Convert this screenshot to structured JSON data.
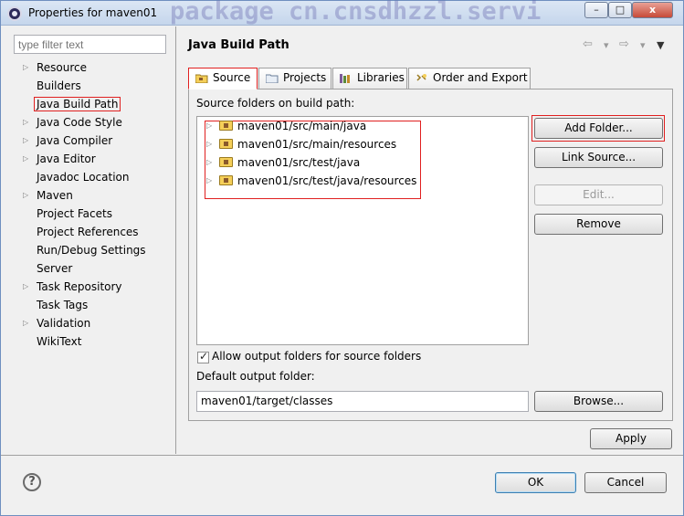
{
  "window": {
    "title": "Properties for maven01",
    "watermark": "package cn.cnsdhzzl.servi",
    "controls": {
      "minimize": "–",
      "maximize": "□",
      "close": "x"
    }
  },
  "filter": {
    "placeholder": "type filter text"
  },
  "nav": {
    "items": [
      {
        "label": "Resource",
        "expandable": true
      },
      {
        "label": "Builders",
        "expandable": false
      },
      {
        "label": "Java Build Path",
        "expandable": false,
        "selected": true
      },
      {
        "label": "Java Code Style",
        "expandable": true
      },
      {
        "label": "Java Compiler",
        "expandable": true
      },
      {
        "label": "Java Editor",
        "expandable": true
      },
      {
        "label": "Javadoc Location",
        "expandable": false
      },
      {
        "label": "Maven",
        "expandable": true
      },
      {
        "label": "Project Facets",
        "expandable": false
      },
      {
        "label": "Project References",
        "expandable": false
      },
      {
        "label": "Run/Debug Settings",
        "expandable": false
      },
      {
        "label": "Server",
        "expandable": false
      },
      {
        "label": "Task Repository",
        "expandable": true
      },
      {
        "label": "Task Tags",
        "expandable": false
      },
      {
        "label": "Validation",
        "expandable": true
      },
      {
        "label": "WikiText",
        "expandable": false
      }
    ]
  },
  "page": {
    "title": "Java Build Path",
    "history": {
      "back": "⇦",
      "back_menu": "▾",
      "forward": "⇨",
      "forward_menu": "▾",
      "menu": "▼"
    }
  },
  "tabs": [
    {
      "label": "Source",
      "active": true
    },
    {
      "label": "Projects",
      "active": false
    },
    {
      "label": "Libraries",
      "active": false
    },
    {
      "label": "Order and Export",
      "active": false
    }
  ],
  "source": {
    "folders_label": "Source folders on build path:",
    "folders": [
      "maven01/src/main/java",
      "maven01/src/main/resources",
      "maven01/src/test/java",
      "maven01/src/test/java/resources"
    ],
    "buttons": {
      "add_folder": "Add Folder...",
      "link_source": "Link Source...",
      "edit": "Edit...",
      "remove": "Remove",
      "browse": "Browse..."
    },
    "allow_output_label": "Allow output folders for source folders",
    "allow_output_checked": true,
    "default_output_label": "Default output folder:",
    "default_output_value": "maven01/target/classes"
  },
  "footer": {
    "apply": "Apply",
    "ok": "OK",
    "cancel": "Cancel",
    "help": "?"
  },
  "colors": {
    "highlight": "#e02020",
    "window_bg": "#f0f0f0",
    "focus": "#3c7fb1"
  }
}
